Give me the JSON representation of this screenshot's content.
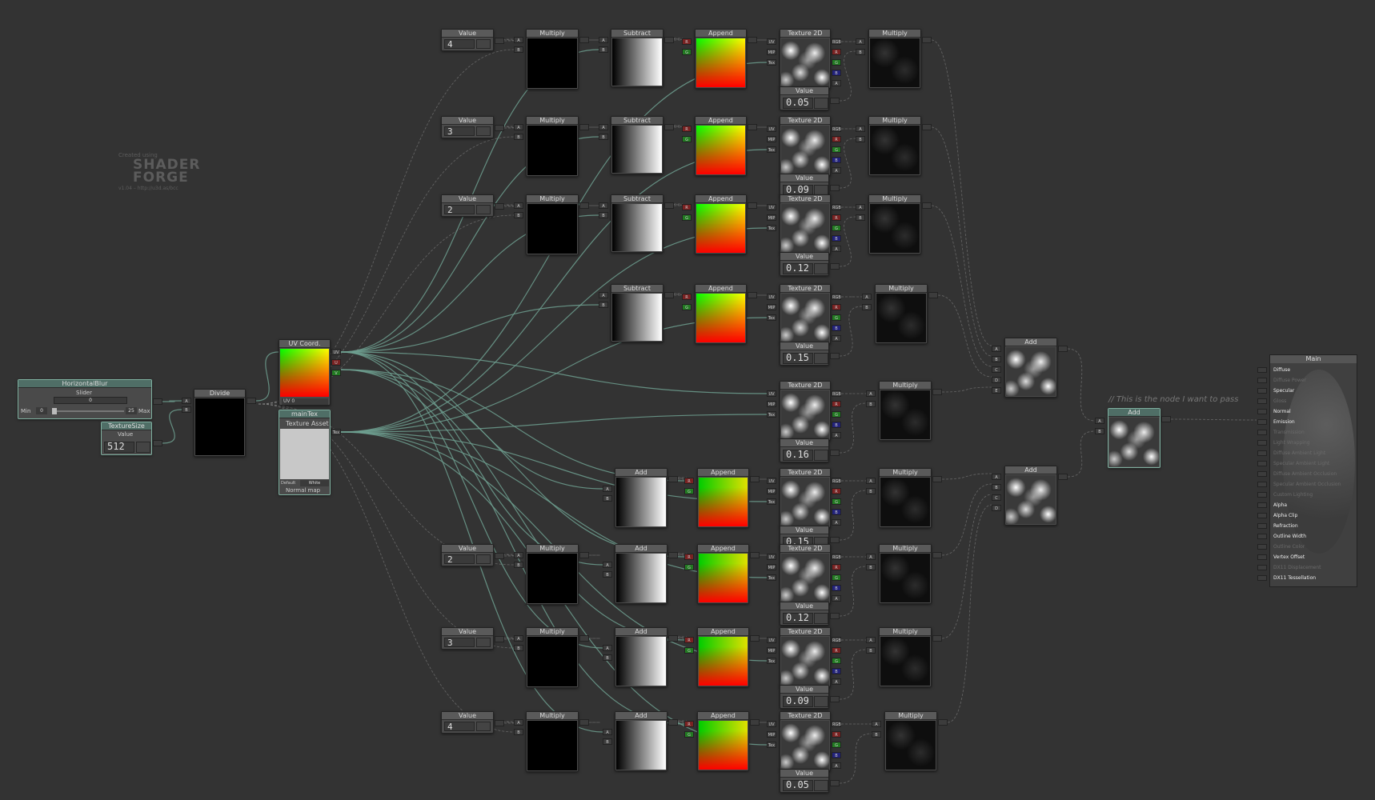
{
  "app": {
    "watermark": {
      "created_using": "Created using",
      "brand_line1": "SHADER",
      "brand_line2": "FORGE",
      "version": "v1.04 – http://u3d.as/bcc"
    },
    "comment": "// This is the node I want to pass"
  },
  "colors": {
    "background": "#333333",
    "node": "#4a4a4a",
    "node_header": "#5a5a5a",
    "selected_header": "#4f6e66",
    "wire": "#8a8a8a",
    "wire_active": "#6fa090"
  },
  "slider": {
    "header": "HorizontalBlur",
    "sub": "Slider",
    "field": "0",
    "min_label": "Min",
    "min": "0",
    "max": "25",
    "max_label": "Max"
  },
  "texsize": {
    "header": "TextureSize",
    "sub": "Value",
    "value": "512"
  },
  "divide": {
    "header": "Divide"
  },
  "uv": {
    "header": "UV Coord.",
    "foot": "UV 0",
    "port_uv": "UV",
    "port_u": "U",
    "port_v": "V"
  },
  "maintex": {
    "header": "mainTex",
    "sub": "Texture Asset",
    "default_label": "Default",
    "default_value": "White",
    "normal": "Normal map",
    "port": "Tex"
  },
  "values_left": [
    {
      "label": "Value",
      "value": "4"
    },
    {
      "label": "Value",
      "value": "3"
    },
    {
      "label": "Value",
      "value": "2"
    },
    {
      "label": "Value",
      "value": "2"
    },
    {
      "label": "Value",
      "value": "3"
    },
    {
      "label": "Value",
      "value": "4"
    }
  ],
  "values_right": [
    {
      "label": "Value",
      "value": "0.05"
    },
    {
      "label": "Value",
      "value": "0.09"
    },
    {
      "label": "Value",
      "value": "0.12"
    },
    {
      "label": "Value",
      "value": "0.15"
    },
    {
      "label": "Value",
      "value": "0.16"
    },
    {
      "label": "Value",
      "value": "0.15"
    },
    {
      "label": "Value",
      "value": "0.12"
    },
    {
      "label": "Value",
      "value": "0.09"
    },
    {
      "label": "Value",
      "value": "0.05"
    }
  ],
  "labels": {
    "multiply": "Multiply",
    "subtract": "Subtract",
    "append": "Append",
    "texture2d": "Texture 2D",
    "add": "Add",
    "main": "Main"
  },
  "ports": {
    "a": "A",
    "b": "B",
    "c": "C",
    "d": "D",
    "e": "E",
    "r": "R",
    "g": "G",
    "bb": "B",
    "aa": "A",
    "rgb": "RGB",
    "uv": "UV",
    "mip": "MIP",
    "tex": "Tex"
  },
  "main_inputs": [
    {
      "label": "Diffuse",
      "active": true
    },
    {
      "label": "Diffuse Power",
      "active": false
    },
    {
      "label": "Specular",
      "active": true
    },
    {
      "label": "Gloss",
      "active": false
    },
    {
      "label": "Normal",
      "active": true
    },
    {
      "label": "Emission",
      "active": true
    },
    {
      "label": "Transmission",
      "active": false
    },
    {
      "label": "Light Wrapping",
      "active": false
    },
    {
      "label": "Diffuse Ambient Light",
      "active": false
    },
    {
      "label": "Specular Ambient Light",
      "active": false
    },
    {
      "label": "Diffuse Ambient Occlusion",
      "active": false
    },
    {
      "label": "Specular Ambient Occlusion",
      "active": false
    },
    {
      "label": "Custom Lighting",
      "active": false
    },
    {
      "label": "Alpha",
      "active": true
    },
    {
      "label": "Alpha Clip",
      "active": true
    },
    {
      "label": "Refraction",
      "active": true
    },
    {
      "label": "Outline Width",
      "active": true
    },
    {
      "label": "Outline Color",
      "active": false
    },
    {
      "label": "Vertex Offset",
      "active": true
    },
    {
      "label": "DX11 Displacement",
      "active": false
    },
    {
      "label": "DX11 Tessellation",
      "active": true
    }
  ]
}
